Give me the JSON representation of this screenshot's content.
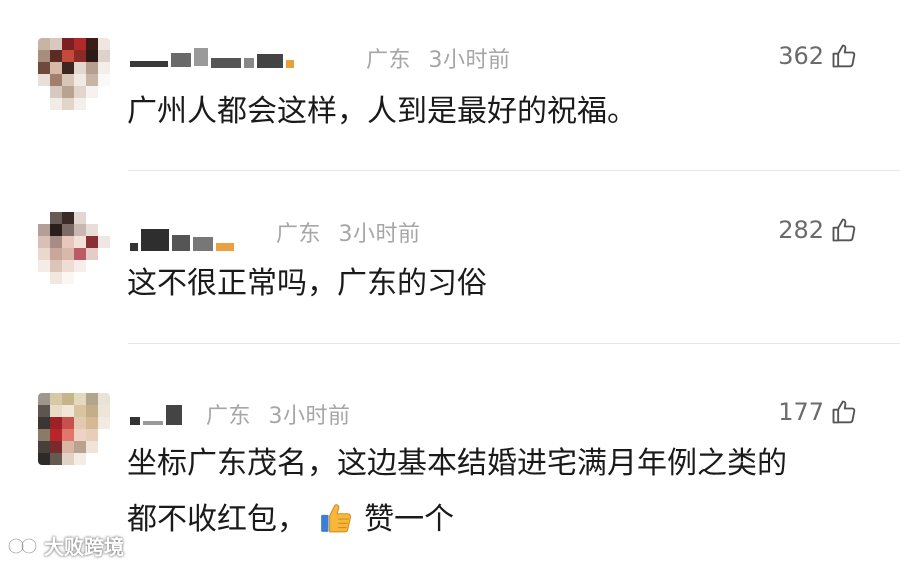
{
  "comments": [
    {
      "location": "广东",
      "time": "3小时前",
      "likes": "362",
      "text": "广州人都会这样，人到是最好的祝福。"
    },
    {
      "location": "广东",
      "time": "3小时前",
      "likes": "282",
      "text": "这不很正常吗，广东的习俗"
    },
    {
      "location": "广东",
      "time": "3小时前",
      "likes": "177",
      "text_line1": "坐标广东茂名，这边基本结婚进宅满月年例之类的",
      "text_line2_before": "都不收红包，",
      "text_line2_after": "赞一个"
    }
  ],
  "watermark": "大败跨境",
  "colors": {
    "meta": "#a6a6a6",
    "likes": "#6b6b6b",
    "text": "#1a1a1a",
    "divider": "#e6e6e6"
  },
  "icons": {
    "like": "thumbs-up-outline-icon",
    "emoji": "thumbs-up-emoji-icon"
  }
}
